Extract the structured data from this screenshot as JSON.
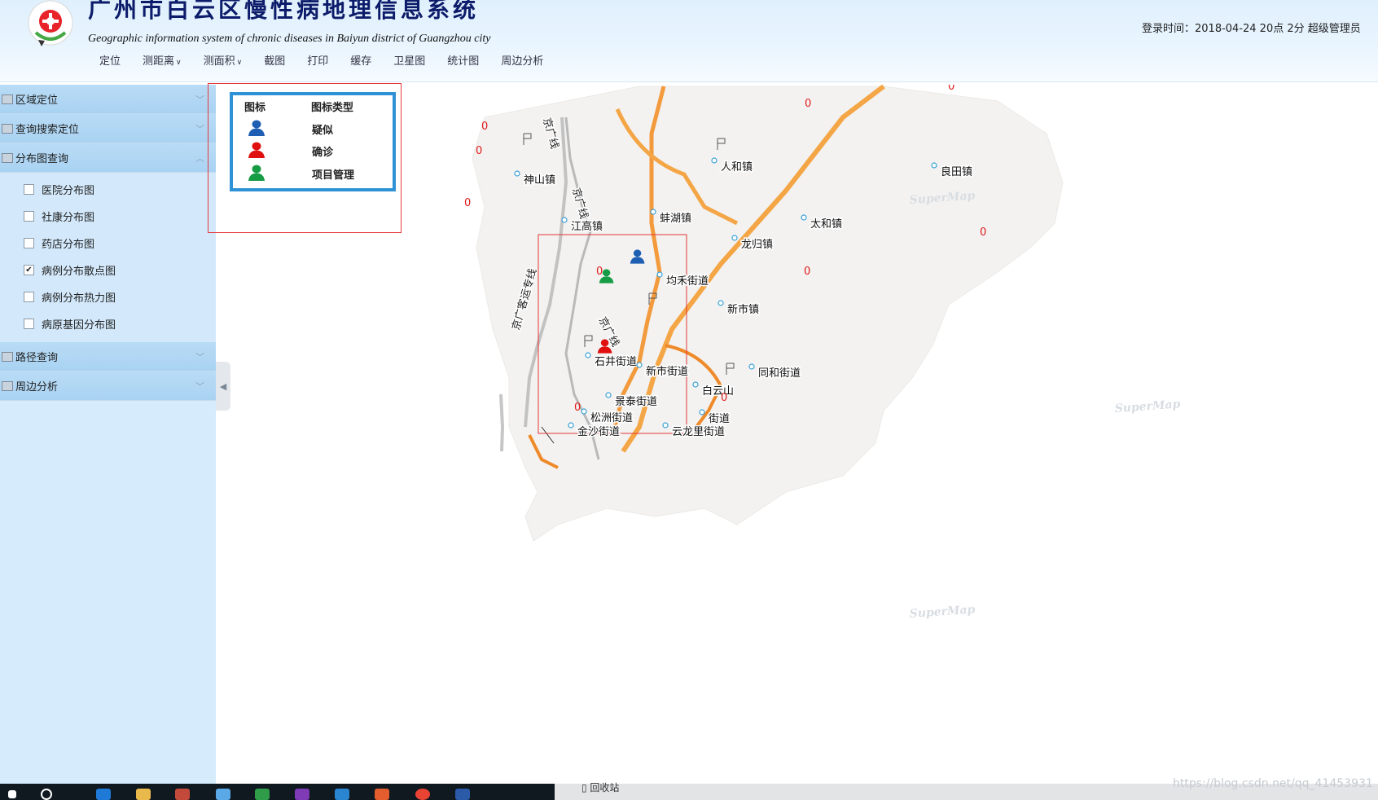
{
  "header": {
    "title_cn": "广州市白云区慢性病地理信息系统",
    "title_en": "Geographic information system of chronic diseases in Baiyun district of Guangzhou city",
    "login_info": "登录时间：2018-04-24  20点  2分    超级管理员"
  },
  "menu": [
    {
      "label": "定位",
      "dropdown": false
    },
    {
      "label": "测距离",
      "dropdown": true
    },
    {
      "label": "测面积",
      "dropdown": true
    },
    {
      "label": "截图",
      "dropdown": false
    },
    {
      "label": "打印",
      "dropdown": false
    },
    {
      "label": "缓存",
      "dropdown": false
    },
    {
      "label": "卫星图",
      "dropdown": false
    },
    {
      "label": "统计图",
      "dropdown": false
    },
    {
      "label": "周边分析",
      "dropdown": false
    }
  ],
  "sidebar": {
    "sections": [
      {
        "label": "区域定位",
        "expanded": false
      },
      {
        "label": "查询搜索定位",
        "expanded": false
      },
      {
        "label": "分布图查询",
        "expanded": true
      },
      {
        "label": "路径查询",
        "expanded": false
      },
      {
        "label": "周边分析",
        "expanded": false
      }
    ],
    "distribution_items": [
      {
        "label": "医院分布图",
        "checked": false
      },
      {
        "label": "社康分布图",
        "checked": false
      },
      {
        "label": "药店分布图",
        "checked": false
      },
      {
        "label": "病例分布散点图",
        "checked": true
      },
      {
        "label": "病例分布热力图",
        "checked": false
      },
      {
        "label": "病原基因分布图",
        "checked": false
      }
    ]
  },
  "legend": {
    "col_icon": "图标",
    "col_type": "图标类型",
    "rows": [
      {
        "label": "疑似",
        "color": "#1f5fb3"
      },
      {
        "label": "确诊",
        "color": "#e01010"
      },
      {
        "label": "项目管理",
        "color": "#169c45"
      }
    ]
  },
  "map": {
    "watermark": "SuperMap",
    "places": [
      "人和镇",
      "良田镇",
      "神山镇",
      "江高镇",
      "蚌湖镇",
      "太和镇",
      "龙归镇",
      "均禾街道",
      "新市镇",
      "石井街道",
      "新市街道",
      "同和街道",
      "白云山",
      "景泰街道",
      "松洲街道",
      "金沙街道",
      "云龙里街道",
      "街道"
    ],
    "rail_labels": [
      "京广线",
      "京广线",
      "京广客运专线",
      "京广线"
    ],
    "zero_label": "0",
    "markers": [
      {
        "type": "疑似",
        "color": "#1f5fb3"
      },
      {
        "type": "项目管理",
        "color": "#169c45"
      },
      {
        "type": "确诊",
        "color": "#e01010"
      }
    ]
  },
  "taskbar": {
    "recycle_label": "回收站",
    "blog_url": "https://blog.csdn.net/qq_41453931"
  }
}
